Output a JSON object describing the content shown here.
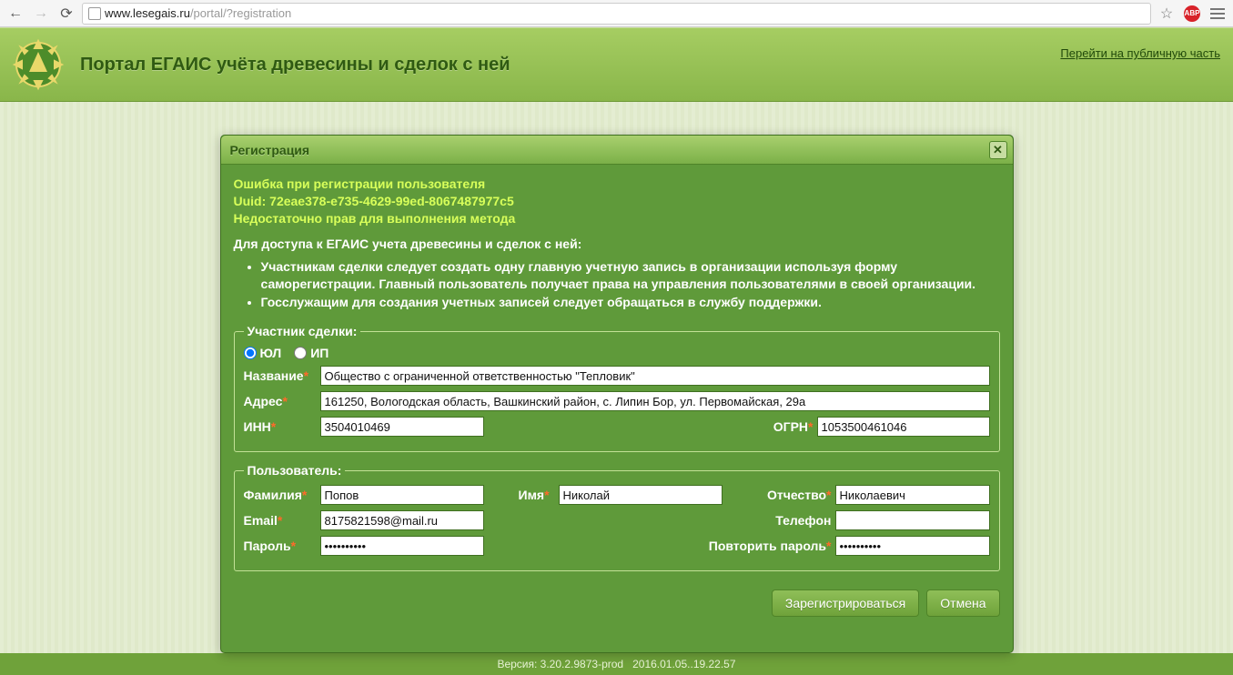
{
  "browser": {
    "url_host": "www.lesegais.ru",
    "url_path": "/portal/?registration",
    "abp_label": "ABP"
  },
  "header": {
    "title": "Портал ЕГАИС учёта древесины и сделок с ней",
    "public_link": "Перейти на публичную часть"
  },
  "modal": {
    "title": "Регистрация",
    "error_line1": "Ошибка при регистрации пользователя",
    "error_line2": "Uuid: 72eae378-e735-4629-99ed-8067487977c5",
    "error_line3": "Недостаточно прав для выполнения метода",
    "intro": "Для доступа к ЕГАИС учета древесины и сделок с ней:",
    "bullet1": "Участникам сделки следует создать одну главную учетную запись в организации используя форму саморегистрации. Главный пользователь получает права на управления пользователями в своей организации.",
    "bullet2": "Госслужащим для создания учетных записей следует обращаться в службу поддержки."
  },
  "participant": {
    "legend": "Участник сделки:",
    "radio_ul": "ЮЛ",
    "radio_ip": "ИП",
    "name_label": "Название",
    "name_value": "Общество с ограниченной ответственностью \"Тепловик\"",
    "addr_label": "Адрес",
    "addr_value": "161250, Вологодская область, Вашкинский район, с. Липин Бор, ул. Первомайская, 29а",
    "inn_label": "ИНН",
    "inn_value": "3504010469",
    "ogrn_label": "ОГРН",
    "ogrn_value": "1053500461046"
  },
  "user": {
    "legend": "Пользователь:",
    "lastname_label": "Фамилия",
    "lastname_value": "Попов",
    "firstname_label": "Имя",
    "firstname_value": "Николай",
    "patronymic_label": "Отчество",
    "patronymic_value": "Николаевич",
    "email_label": "Email",
    "email_value": "8175821598@mail.ru",
    "phone_label": "Телефон",
    "phone_value": "",
    "password_label": "Пароль",
    "password_value": "••••••••••",
    "password2_label": "Повторить пароль",
    "password2_value": "••••••••••"
  },
  "actions": {
    "register": "Зарегистрироваться",
    "cancel": "Отмена"
  },
  "footer": {
    "version": "Версия: 3.20.2.9873-prod",
    "build": "2016.01.05..19.22.57"
  }
}
